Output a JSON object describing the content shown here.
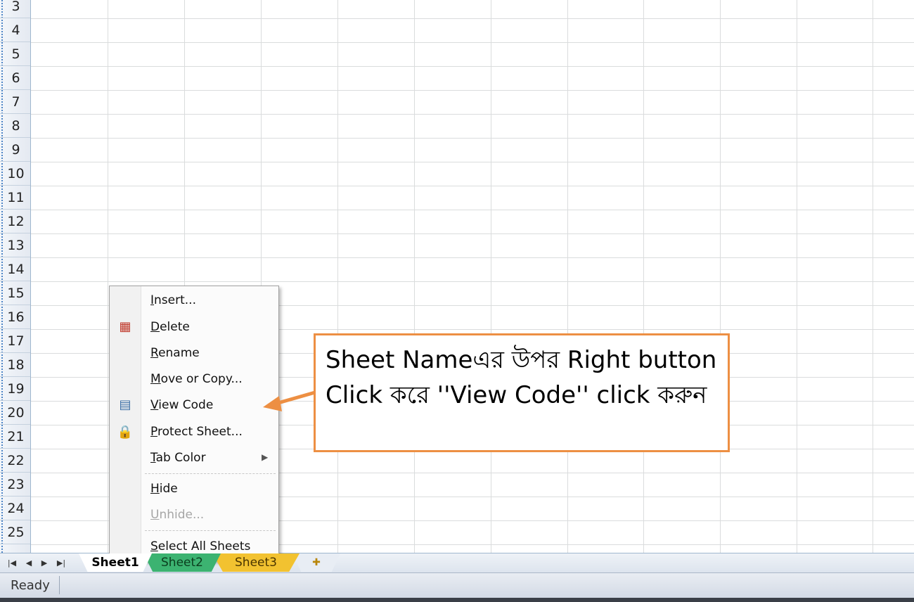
{
  "grid": {
    "row_numbers": [
      "3",
      "4",
      "5",
      "6",
      "7",
      "8",
      "9",
      "10",
      "11",
      "12",
      "13",
      "14",
      "15",
      "16",
      "17",
      "18",
      "19",
      "20",
      "21",
      "22",
      "23",
      "24",
      "25"
    ]
  },
  "sheet_tabs": {
    "nav_icons": [
      "first-sheet-icon",
      "prev-sheet-icon",
      "next-sheet-icon",
      "last-sheet-icon"
    ],
    "tabs": [
      {
        "label": "Sheet1",
        "color": "#ffffff"
      },
      {
        "label": "Sheet2",
        "color": "#3cb371"
      },
      {
        "label": "Sheet3",
        "color": "#f2c230"
      }
    ],
    "new_sheet_icon": "insert-worksheet-icon"
  },
  "status_bar": {
    "text": "Ready"
  },
  "context_menu": {
    "items": [
      {
        "label": "Insert...",
        "underline": "I",
        "enabled": true
      },
      {
        "label": "Delete",
        "underline": "D",
        "enabled": true,
        "icon": "delete-sheet-icon"
      },
      {
        "label": "Rename",
        "underline": "R",
        "enabled": true
      },
      {
        "label": "Move or Copy...",
        "underline": "M",
        "enabled": true
      },
      {
        "label": "View Code",
        "underline": "V",
        "enabled": true,
        "icon": "view-code-icon",
        "highlighted": true
      },
      {
        "label": "Protect Sheet...",
        "underline": "P",
        "enabled": true,
        "icon": "lock-icon"
      },
      {
        "label": "Tab Color",
        "underline": "T",
        "enabled": true,
        "submenu": true
      },
      {
        "label": "Hide",
        "underline": "H",
        "enabled": true
      },
      {
        "label": "Unhide...",
        "underline": "U",
        "enabled": false
      },
      {
        "label": "Select All Sheets",
        "underline": "S",
        "enabled": true
      }
    ]
  },
  "callout": {
    "text": "Sheet Nameএর উপর Right button Click করে ''View Code'' click করুন",
    "border_color": "#ed8f43"
  }
}
